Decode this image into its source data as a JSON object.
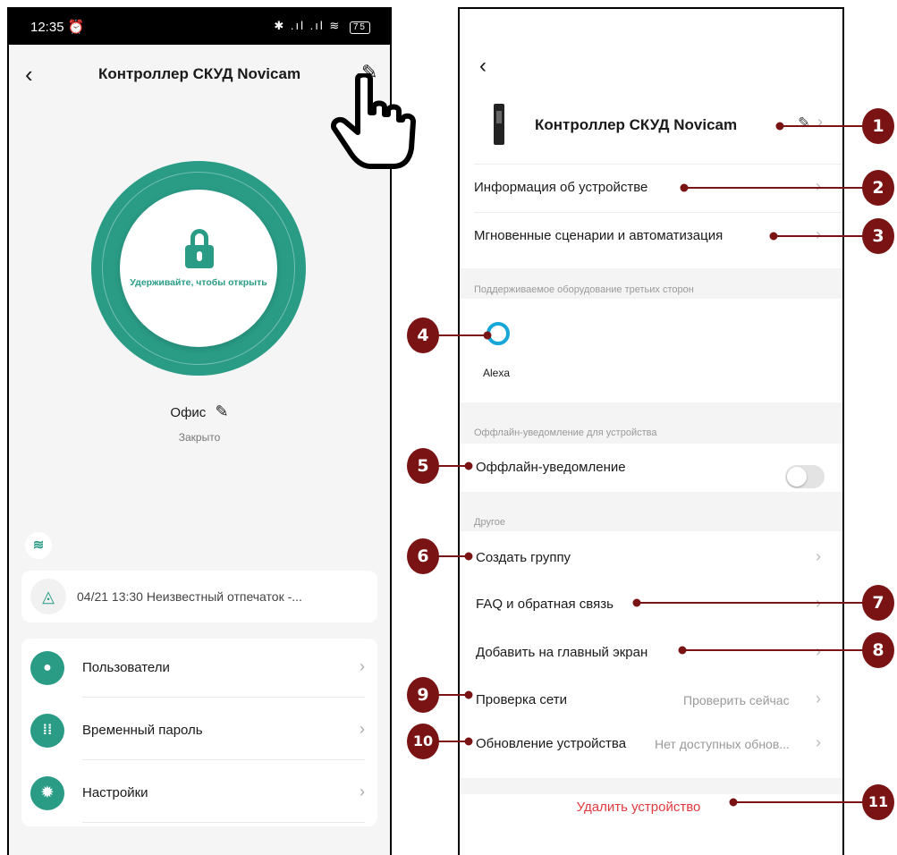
{
  "left_screen": {
    "status_bar": {
      "time": "12:35 ⏰",
      "signal": "✱ .ıl .ıl ≋",
      "battery": "75"
    },
    "header": {
      "title": "Контроллер СКУД Novicam",
      "back_icon": "‹",
      "edit_icon": "✎"
    },
    "lock": {
      "hint": "Удерживайте, чтобы открыть"
    },
    "room_name": "Офис",
    "room_status": "Закрыто",
    "notification": {
      "text": "04/21 13:30  Неизвестный отпечаток -..."
    },
    "menu": [
      {
        "label": "Пользователи",
        "icon": "user-icon"
      },
      {
        "label": "Временный пароль",
        "icon": "keypad-icon"
      },
      {
        "label": "Настройки",
        "icon": "gear-icon"
      }
    ],
    "accent_color": "#2a9c86"
  },
  "right_screen": {
    "device_name": "Контроллер СКУД Novicam",
    "rows": {
      "device_info": "Информация об устройстве",
      "scenes": "Мгновенные сценарии и автоматизация"
    },
    "third_party_label": "Поддерживаемое оборудование третьих сторон",
    "alexa_label": "Alexa",
    "offline_section_label": "Оффлайн-уведомление для устройства",
    "offline_label": "Оффлайн-уведомление",
    "offline_enabled": false,
    "other_label": "Другое",
    "create_group": "Создать группу",
    "faq": "FAQ и обратная связь",
    "add_home": "Добавить на главный экран",
    "network_check": "Проверка сети",
    "network_check_value": "Проверить сейчас",
    "update": "Обновление устройства",
    "update_value": "Нет доступных обнов...",
    "delete": "Удалить устройство",
    "delete_color": "#e0393e"
  },
  "callouts": [
    "1",
    "2",
    "3",
    "4",
    "5",
    "6",
    "7",
    "8",
    "9",
    "10",
    "11"
  ],
  "callout_color": "#7a1414"
}
